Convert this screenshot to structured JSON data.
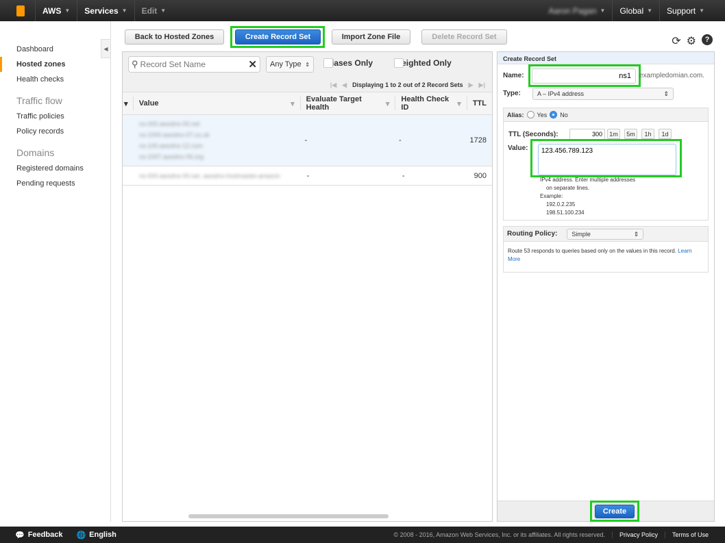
{
  "topbar": {
    "brand": "AWS",
    "services": "Services",
    "edit": "Edit",
    "user": "Aaron Pagan",
    "region": "Global",
    "support": "Support"
  },
  "sidebar": {
    "items": [
      {
        "label": "Dashboard"
      },
      {
        "label": "Hosted zones",
        "active": true
      },
      {
        "label": "Health checks"
      }
    ],
    "sections": [
      {
        "title": "Traffic flow",
        "items": [
          "Traffic policies",
          "Policy records"
        ]
      },
      {
        "title": "Domains",
        "items": [
          "Registered domains",
          "Pending requests"
        ]
      }
    ]
  },
  "toolbar": {
    "back": "Back to Hosted Zones",
    "create": "Create Record Set",
    "import": "Import Zone File",
    "delete": "Delete Record Set"
  },
  "filter": {
    "search_placeholder": "Record Set Name",
    "type": "Any Type",
    "aliases": "Aliases Only",
    "weighted": "Weighted Only",
    "pager": "Displaying 1 to 2 out of 2 Record Sets"
  },
  "table": {
    "columns": [
      "Value",
      "Evaluate Target Health",
      "Health Check ID",
      "TTL"
    ],
    "rows": [
      {
        "eth": "-",
        "hc": "-",
        "ttl": "1728"
      },
      {
        "eth": "-",
        "hc": "-",
        "ttl": "900"
      }
    ]
  },
  "form": {
    "title": "Create Record Set",
    "name_label": "Name:",
    "name_value": "ns1",
    "domain_suffix": "exampledomian.com.",
    "type_label": "Type:",
    "type_value": "A – IPv4 address",
    "alias_label": "Alias:",
    "alias_yes": "Yes",
    "alias_no": "No",
    "alias_selected": "No",
    "ttl_label": "TTL (Seconds):",
    "ttl_value": "300",
    "ttl_buttons": [
      "1m",
      "5m",
      "1h",
      "1d"
    ],
    "value_label": "Value:",
    "value": "123.456.789.123",
    "help1": "IPv4 address. Enter multiple addresses",
    "help2": "on separate lines.",
    "help3": "Example:",
    "ex1": "192.0.2.235",
    "ex2": "198.51.100.234",
    "routing_label": "Routing Policy:",
    "routing_value": "Simple",
    "routing_help": "Route 53 responds to queries based only on the values in this record.",
    "learn_more": "Learn More",
    "create": "Create"
  },
  "footer": {
    "feedback": "Feedback",
    "language": "English",
    "copyright": "© 2008 - 2016, Amazon Web Services, Inc. or its affiliates. All rights reserved.",
    "privacy": "Privacy Policy",
    "terms": "Terms of Use"
  },
  "colors": {
    "highlight": "#22cc22",
    "primary": "#1a64c2",
    "accent": "#ff9900"
  }
}
